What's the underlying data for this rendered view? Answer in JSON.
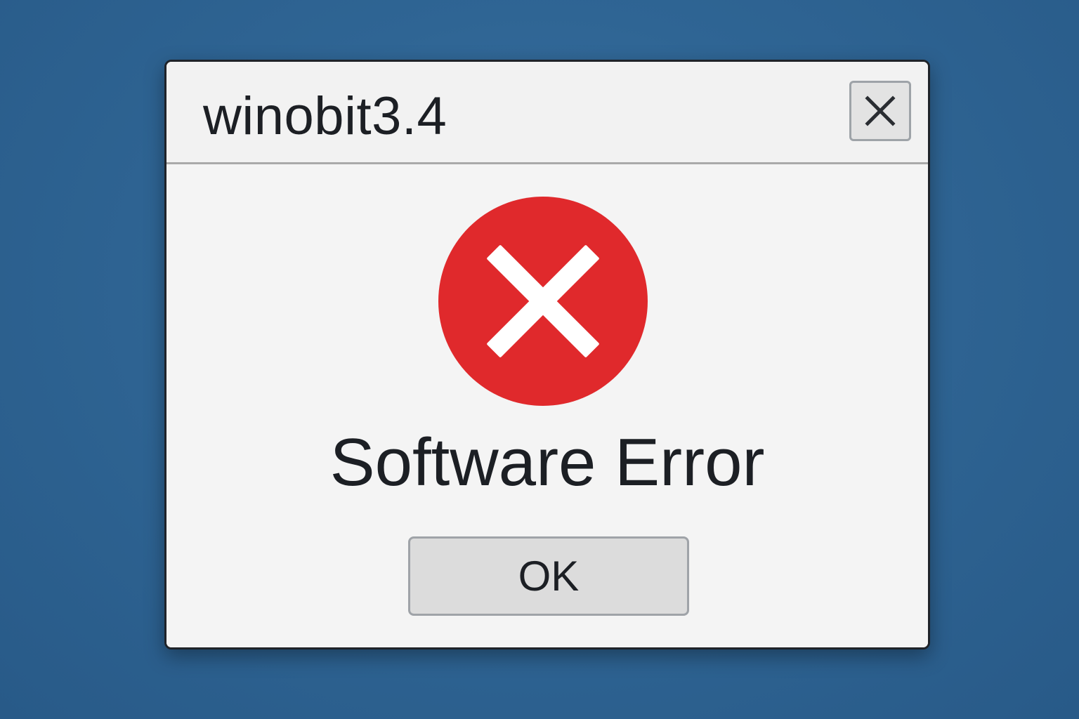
{
  "window": {
    "title": "winobit3.4",
    "close_icon": "close-icon"
  },
  "dialog": {
    "icon": "error-icon",
    "message": "Software Error",
    "ok_label": "OK"
  },
  "colors": {
    "desktop": "#2f6594",
    "dialog_bg": "#f3f3f3",
    "error_red": "#e0292c",
    "text": "#1c1f24"
  }
}
